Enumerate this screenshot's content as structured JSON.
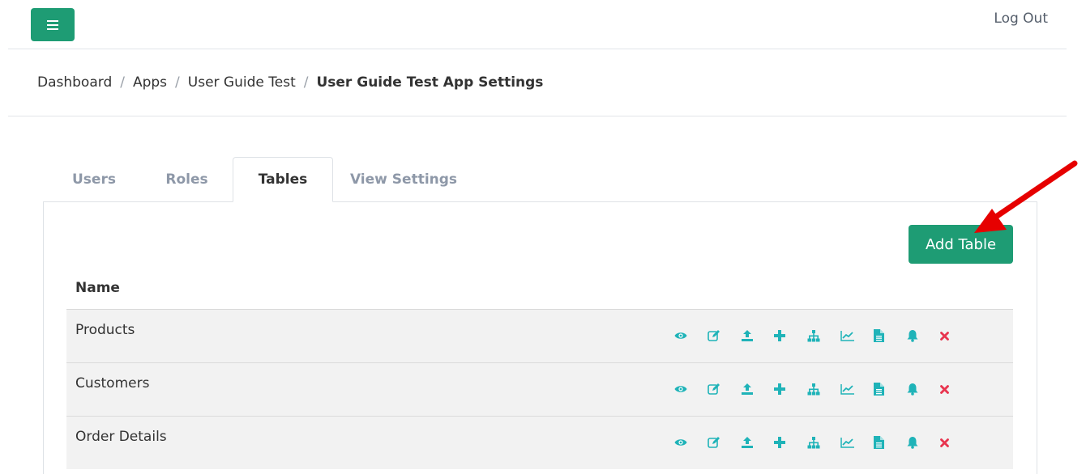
{
  "topbar": {
    "menu_icon": "hamburger-menu-icon",
    "logout_label": "Log Out"
  },
  "breadcrumb": {
    "items": [
      "Dashboard",
      "Apps",
      "User Guide Test"
    ],
    "separator": "/",
    "current": "User Guide Test App Settings"
  },
  "tabs": [
    {
      "label": "Users",
      "active": false
    },
    {
      "label": "Roles",
      "active": false
    },
    {
      "label": "Tables",
      "active": true
    },
    {
      "label": "View Settings",
      "active": false
    }
  ],
  "main": {
    "add_table_label": "Add Table",
    "column_name_header": "Name",
    "rows": [
      {
        "name": "Products"
      },
      {
        "name": "Customers"
      },
      {
        "name": "Order Details"
      }
    ],
    "row_actions": [
      "eye-icon",
      "edit-icon",
      "upload-icon",
      "plus-icon",
      "sitemap-icon",
      "chart-icon",
      "document-icon",
      "bell-icon",
      "delete-icon"
    ]
  },
  "colors": {
    "primary": "#1e9c74",
    "action_icon": "#1fb3b8",
    "delete_icon": "#e8354f",
    "annotation_arrow": "#e60000"
  }
}
